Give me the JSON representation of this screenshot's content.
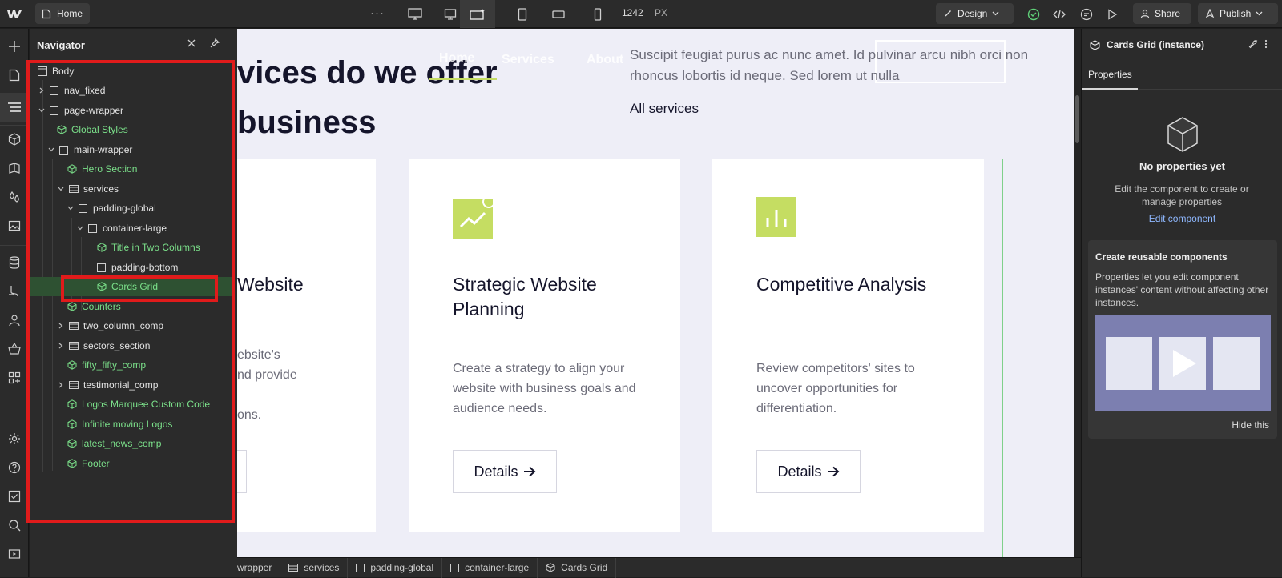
{
  "app": {
    "logo_icon": "webflow-logo-icon"
  },
  "topbar": {
    "home_label": "Home",
    "more_label": "···",
    "width_value": "1242",
    "width_unit": "PX",
    "design_label": "Design",
    "share_label": "Share",
    "publish_label": "Publish"
  },
  "navigator": {
    "title": "Navigator",
    "items": [
      {
        "label": "Body",
        "type": "element"
      },
      {
        "label": "nav_fixed",
        "type": "element"
      },
      {
        "label": "page-wrapper",
        "type": "element"
      },
      {
        "label": "Global Styles",
        "type": "component"
      },
      {
        "label": "main-wrapper",
        "type": "element"
      },
      {
        "label": "Hero Section",
        "type": "component"
      },
      {
        "label": "services",
        "type": "section"
      },
      {
        "label": "padding-global",
        "type": "element"
      },
      {
        "label": "container-large",
        "type": "element"
      },
      {
        "label": "Title in Two Columns",
        "type": "component"
      },
      {
        "label": "padding-bottom",
        "type": "element"
      },
      {
        "label": "Cards Grid",
        "type": "component",
        "selected": true
      },
      {
        "label": "Counters",
        "type": "component"
      },
      {
        "label": "two_column_comp",
        "type": "section"
      },
      {
        "label": "sectors_section",
        "type": "section"
      },
      {
        "label": "fifty_fifty_comp",
        "type": "component"
      },
      {
        "label": "testimonial_comp",
        "type": "section"
      },
      {
        "label": "Logos Marquee Custom Code",
        "type": "component"
      },
      {
        "label": "Infinite moving Logos",
        "type": "component"
      },
      {
        "label": "latest_news_comp",
        "type": "component"
      },
      {
        "label": "Footer",
        "type": "component"
      }
    ]
  },
  "canvas": {
    "heading": "vices do we offer\nbusiness",
    "intro": "Suscipit feugiat purus ac nunc amet. Id pulvinar arcu nibh orci non rhoncus lobortis id neque. Sed lorem ut nulla",
    "all_services": "All services",
    "ghost_nav": [
      "Home",
      "Services",
      "About"
    ],
    "cards": [
      {
        "title": "Website",
        "desc": "ebsite's\nnd provide\n\nons.",
        "button": ""
      },
      {
        "title": "Strategic Website Planning",
        "desc": "Create a strategy to align your website with business goals and audience needs.",
        "button": "Details"
      },
      {
        "title": "Competitive Analysis",
        "desc": "Review competitors' sites to uncover opportunities for differentiation.",
        "button": "Details"
      }
    ]
  },
  "breadcrumb": [
    "wrapper",
    "services",
    "padding-global",
    "container-large",
    "Cards Grid"
  ],
  "right_panel": {
    "header": "Cards Grid (instance)",
    "tab": "Properties",
    "empty_title": "No properties yet",
    "empty_desc": "Edit the component to create or manage properties",
    "edit_link": "Edit component",
    "promo_title": "Create reusable components",
    "promo_body": "Properties let you edit component instances' content without affecting other instances.",
    "promo_hide": "Hide this"
  },
  "colors": {
    "accent_green": "#7be08a",
    "card_accent": "#c5dd62",
    "highlight_red": "#e01b1b",
    "selection": "#2e5132"
  }
}
